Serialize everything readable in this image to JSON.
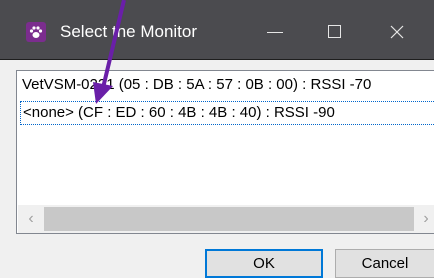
{
  "window": {
    "title": "Select the Monitor",
    "icon": "paw-icon",
    "controls": [
      "minimize-icon",
      "maximize-icon",
      "close-icon"
    ]
  },
  "monitor_list": {
    "items": [
      {
        "label": "VetVSM-0221 (05 : DB : 5A : 57 : 0B : 00) : RSSI -70"
      },
      {
        "label": "<none> (CF : ED : 60 : 4B : 4B : 40) : RSSI -90"
      }
    ]
  },
  "buttons": {
    "ok": "OK",
    "cancel": "Cancel"
  },
  "colors": {
    "titlebar": "#4b4b4f",
    "annotation_arrow": "#6a1fa8",
    "focus_border": "#0078d7"
  }
}
